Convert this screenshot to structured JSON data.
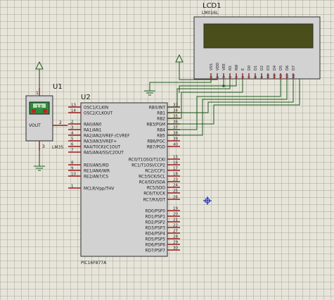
{
  "lcd": {
    "ref": "LCD1",
    "model": "LM016L",
    "pins": [
      {
        "name": "VSS",
        "num": "1"
      },
      {
        "name": "VDD",
        "num": "2"
      },
      {
        "name": "VEE",
        "num": "3"
      },
      {
        "name": "RS",
        "num": "4"
      },
      {
        "name": "RW",
        "num": "5"
      },
      {
        "name": "E",
        "num": "6"
      },
      {
        "name": "D0",
        "num": "7"
      },
      {
        "name": "D1",
        "num": "8"
      },
      {
        "name": "D2",
        "num": "9"
      },
      {
        "name": "D3",
        "num": "10"
      },
      {
        "name": "D4",
        "num": "11"
      },
      {
        "name": "D5",
        "num": "12"
      },
      {
        "name": "D6",
        "num": "13"
      },
      {
        "name": "D7",
        "num": "14"
      }
    ]
  },
  "sensor": {
    "ref": "U1",
    "model": "LM35",
    "reading": "1.0",
    "out_label": "VOUT",
    "pins": {
      "vcc": "1",
      "out": "2",
      "gnd": "3"
    }
  },
  "mcu": {
    "ref": "U2",
    "model": "PIC16F877A",
    "left_pins": [
      {
        "name": "OSC1/CLKIN",
        "num": "13"
      },
      {
        "name": "OSC2/CLKOUT",
        "num": "14"
      },
      {
        "name": "RA0/AN0",
        "num": "2"
      },
      {
        "name": "RA1/AN1",
        "num": "3"
      },
      {
        "name": "RA2/AN2/VREF-/CVREF",
        "num": "4"
      },
      {
        "name": "RA3/AN3/VREF+",
        "num": "5"
      },
      {
        "name": "RA4/T0CKI/C1OUT",
        "num": "6"
      },
      {
        "name": "RA5/AN4/SS/C2OUT",
        "num": "7"
      },
      {
        "name": "RE0/AN5/RD",
        "num": "8"
      },
      {
        "name": "RE1/AN6/WR",
        "num": "9"
      },
      {
        "name": "RE2/AN7/CS",
        "num": "10"
      },
      {
        "name": "MCLR/Vpp/THV",
        "num": "1"
      }
    ],
    "right_pins": [
      {
        "name": "RB0/INT",
        "num": "33"
      },
      {
        "name": "RB1",
        "num": "34"
      },
      {
        "name": "RB2",
        "num": "35"
      },
      {
        "name": "RB3/PGM",
        "num": "36"
      },
      {
        "name": "RB4",
        "num": "37"
      },
      {
        "name": "RB5",
        "num": "38"
      },
      {
        "name": "RB6/PGC",
        "num": "39"
      },
      {
        "name": "RB7/PGD",
        "num": "40"
      },
      {
        "name": "RC0/T1OSO/T1CKI",
        "num": "15"
      },
      {
        "name": "RC1/T1OSI/CCP2",
        "num": "16"
      },
      {
        "name": "RC2/CCP1",
        "num": "17"
      },
      {
        "name": "RC3/SCK/SCL",
        "num": "18"
      },
      {
        "name": "RC4/SDI/SDA",
        "num": "23"
      },
      {
        "name": "RC5/SDO",
        "num": "24"
      },
      {
        "name": "RC6/TX/CK",
        "num": "25"
      },
      {
        "name": "RC7/RX/DT",
        "num": "26"
      },
      {
        "name": "RD0/PSP0",
        "num": "19"
      },
      {
        "name": "RD1/PSP1",
        "num": "20"
      },
      {
        "name": "RD2/PSP2",
        "num": "21"
      },
      {
        "name": "RD3/PSP3",
        "num": "22"
      },
      {
        "name": "RD4/PSP4",
        "num": "27"
      },
      {
        "name": "RD5/PSP5",
        "num": "28"
      },
      {
        "name": "RD6/PSP6",
        "num": "29"
      },
      {
        "name": "RD7/PSP7",
        "num": "30"
      }
    ]
  },
  "colors": {
    "grid_bg": "#e7e5da",
    "component_fill": "#d2d2d2",
    "lcd_screen": "#4a4e1b",
    "pin_color": "#9b1b1b",
    "wire_green": "#1c5a1c",
    "marker_blue": "#1a2fb8",
    "sensor_display": "#2f8d3a"
  }
}
